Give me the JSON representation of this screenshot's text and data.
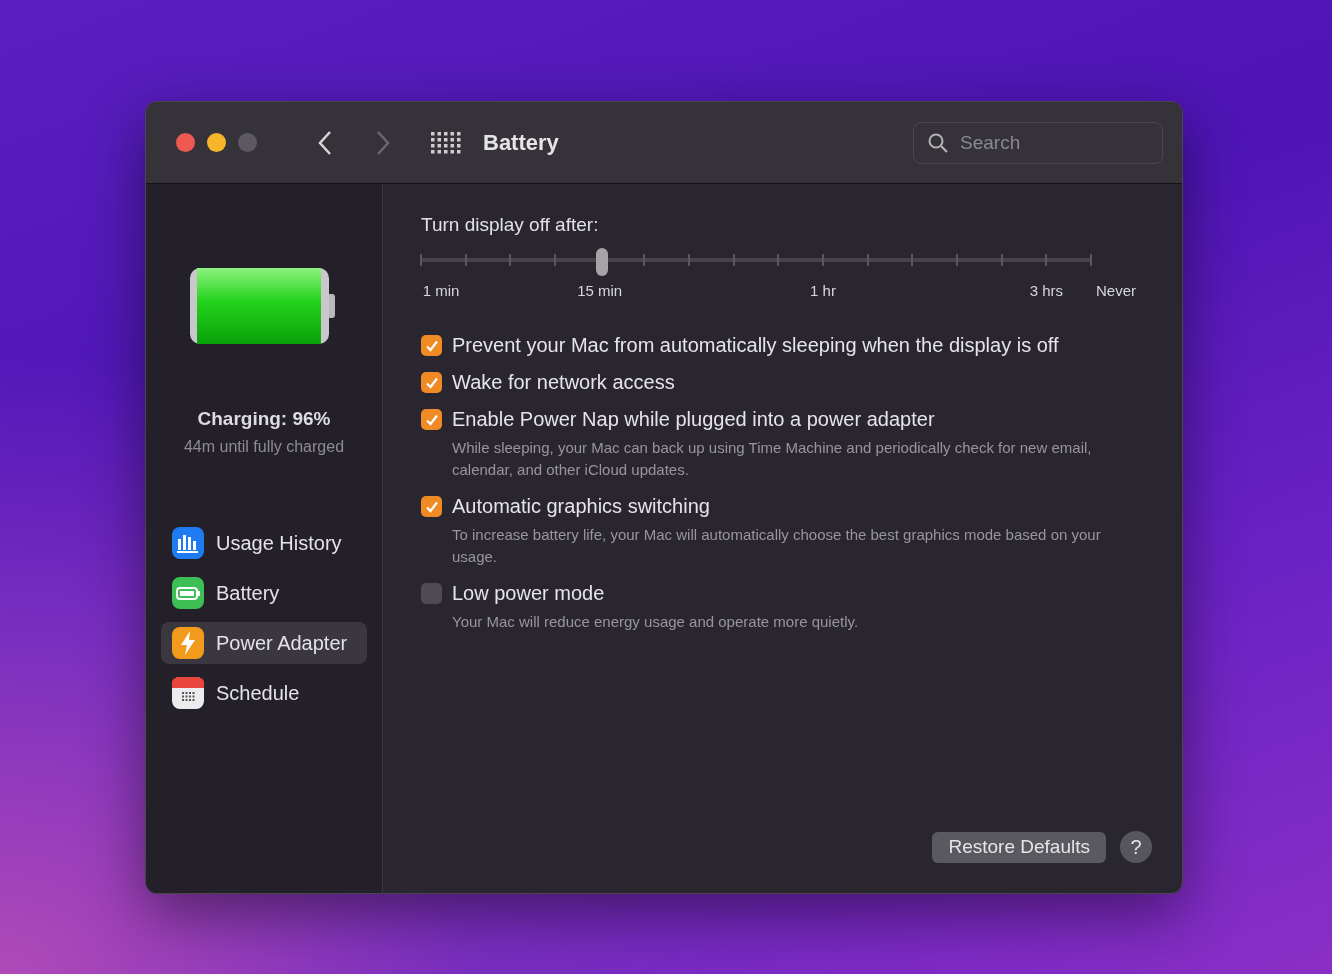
{
  "window": {
    "title": "Battery",
    "search": {
      "placeholder": "Search"
    }
  },
  "sidebar": {
    "status": "Charging: 96%",
    "detail": "44m until fully charged",
    "items": [
      {
        "label": "Usage History",
        "kind": "history",
        "selected": false
      },
      {
        "label": "Battery",
        "kind": "battery",
        "selected": false
      },
      {
        "label": "Power Adapter",
        "kind": "adapter",
        "selected": true
      },
      {
        "label": "Schedule",
        "kind": "schedule",
        "selected": false
      }
    ]
  },
  "display_off": {
    "label": "Turn display off after:",
    "level": 0.27,
    "ticks": [
      "1 min",
      "15 min",
      "1 hr",
      "3 hrs",
      "Never"
    ]
  },
  "options": [
    {
      "label": "Prevent your Mac from automatically sleeping when the display is off",
      "checked": true
    },
    {
      "label": "Wake for network access",
      "checked": true
    },
    {
      "label": "Enable Power Nap while plugged into a power adapter",
      "checked": true,
      "description": "While sleeping, your Mac can back up using Time Machine and periodically check for new email, calendar, and other iCloud updates."
    },
    {
      "label": "Automatic graphics switching",
      "checked": true,
      "description": "To increase battery life, your Mac will automatically choose the best graphics mode based on your usage."
    },
    {
      "label": "Low power mode",
      "checked": false,
      "description": "Your Mac will reduce energy usage and operate more quietly."
    }
  ],
  "buttons": {
    "restore": "Restore Defaults",
    "help": "?"
  }
}
